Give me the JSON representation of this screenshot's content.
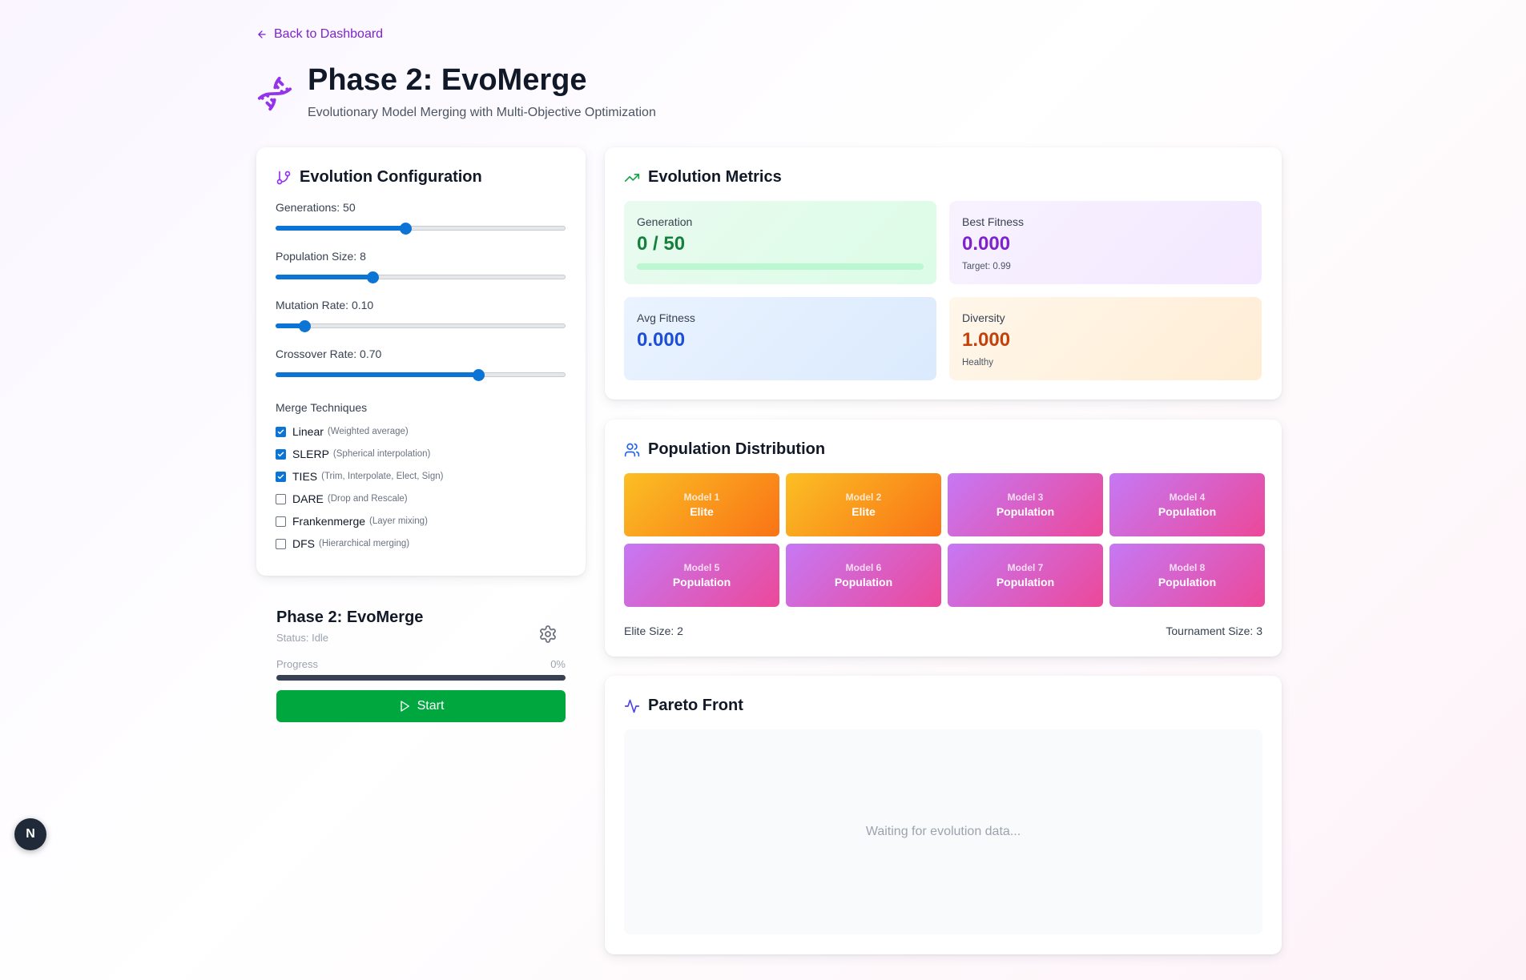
{
  "nav": {
    "back_label": "Back to Dashboard"
  },
  "header": {
    "title": "Phase 2: EvoMerge",
    "subtitle": "Evolutionary Model Merging with Multi-Objective Optimization"
  },
  "config": {
    "title": "Evolution Configuration",
    "sliders": [
      {
        "label": "Generations: 50",
        "value": 50,
        "min": 0,
        "max": 112
      },
      {
        "label": "Population Size: 8",
        "value": 8,
        "min": 0,
        "max": 24
      },
      {
        "label": "Mutation Rate: 0.10",
        "value": 0.1,
        "min": 0,
        "max": 1
      },
      {
        "label": "Crossover Rate: 0.70",
        "value": 0.7,
        "min": 0,
        "max": 1
      }
    ],
    "merge_title": "Merge Techniques",
    "techniques": [
      {
        "name": "Linear",
        "desc": "(Weighted average)",
        "checked": true
      },
      {
        "name": "SLERP",
        "desc": "(Spherical interpolation)",
        "checked": true
      },
      {
        "name": "TIES",
        "desc": "(Trim, Interpolate, Elect, Sign)",
        "checked": true
      },
      {
        "name": "DARE",
        "desc": "(Drop and Rescale)",
        "checked": false
      },
      {
        "name": "Frankenmerge",
        "desc": "(Layer mixing)",
        "checked": false
      },
      {
        "name": "DFS",
        "desc": "(Hierarchical merging)",
        "checked": false
      }
    ]
  },
  "control": {
    "title": "Phase 2: EvoMerge",
    "status": "Status: Idle",
    "progress_label": "Progress",
    "progress_text": "0%",
    "progress": 0,
    "start_label": "Start"
  },
  "metrics": {
    "title": "Evolution Metrics",
    "generation": {
      "label": "Generation",
      "value": "0 / 50",
      "progress": 0
    },
    "best_fitness": {
      "label": "Best Fitness",
      "value": "0.000",
      "sub": "Target: 0.99"
    },
    "avg_fitness": {
      "label": "Avg Fitness",
      "value": "0.000"
    },
    "diversity": {
      "label": "Diversity",
      "value": "1.000",
      "sub": "Healthy"
    }
  },
  "population": {
    "title": "Population Distribution",
    "models": [
      {
        "name": "Model 1",
        "role": "Elite"
      },
      {
        "name": "Model 2",
        "role": "Elite"
      },
      {
        "name": "Model 3",
        "role": "Population"
      },
      {
        "name": "Model 4",
        "role": "Population"
      },
      {
        "name": "Model 5",
        "role": "Population"
      },
      {
        "name": "Model 6",
        "role": "Population"
      },
      {
        "name": "Model 7",
        "role": "Population"
      },
      {
        "name": "Model 8",
        "role": "Population"
      }
    ],
    "elite_size": "Elite Size: 2",
    "tournament_size": "Tournament Size: 3"
  },
  "pareto": {
    "title": "Pareto Front",
    "empty_text": "Waiting for evolution data..."
  },
  "colors": {
    "accent": "#7e22ce",
    "slider": "#0b74d5",
    "start_button": "#00a63e",
    "generation_value": "#15803d",
    "best_fitness_value": "#7e22ce",
    "avg_fitness_value": "#1d4ed8",
    "diversity_value": "#c2410c"
  },
  "badge": {
    "letter": "N"
  }
}
